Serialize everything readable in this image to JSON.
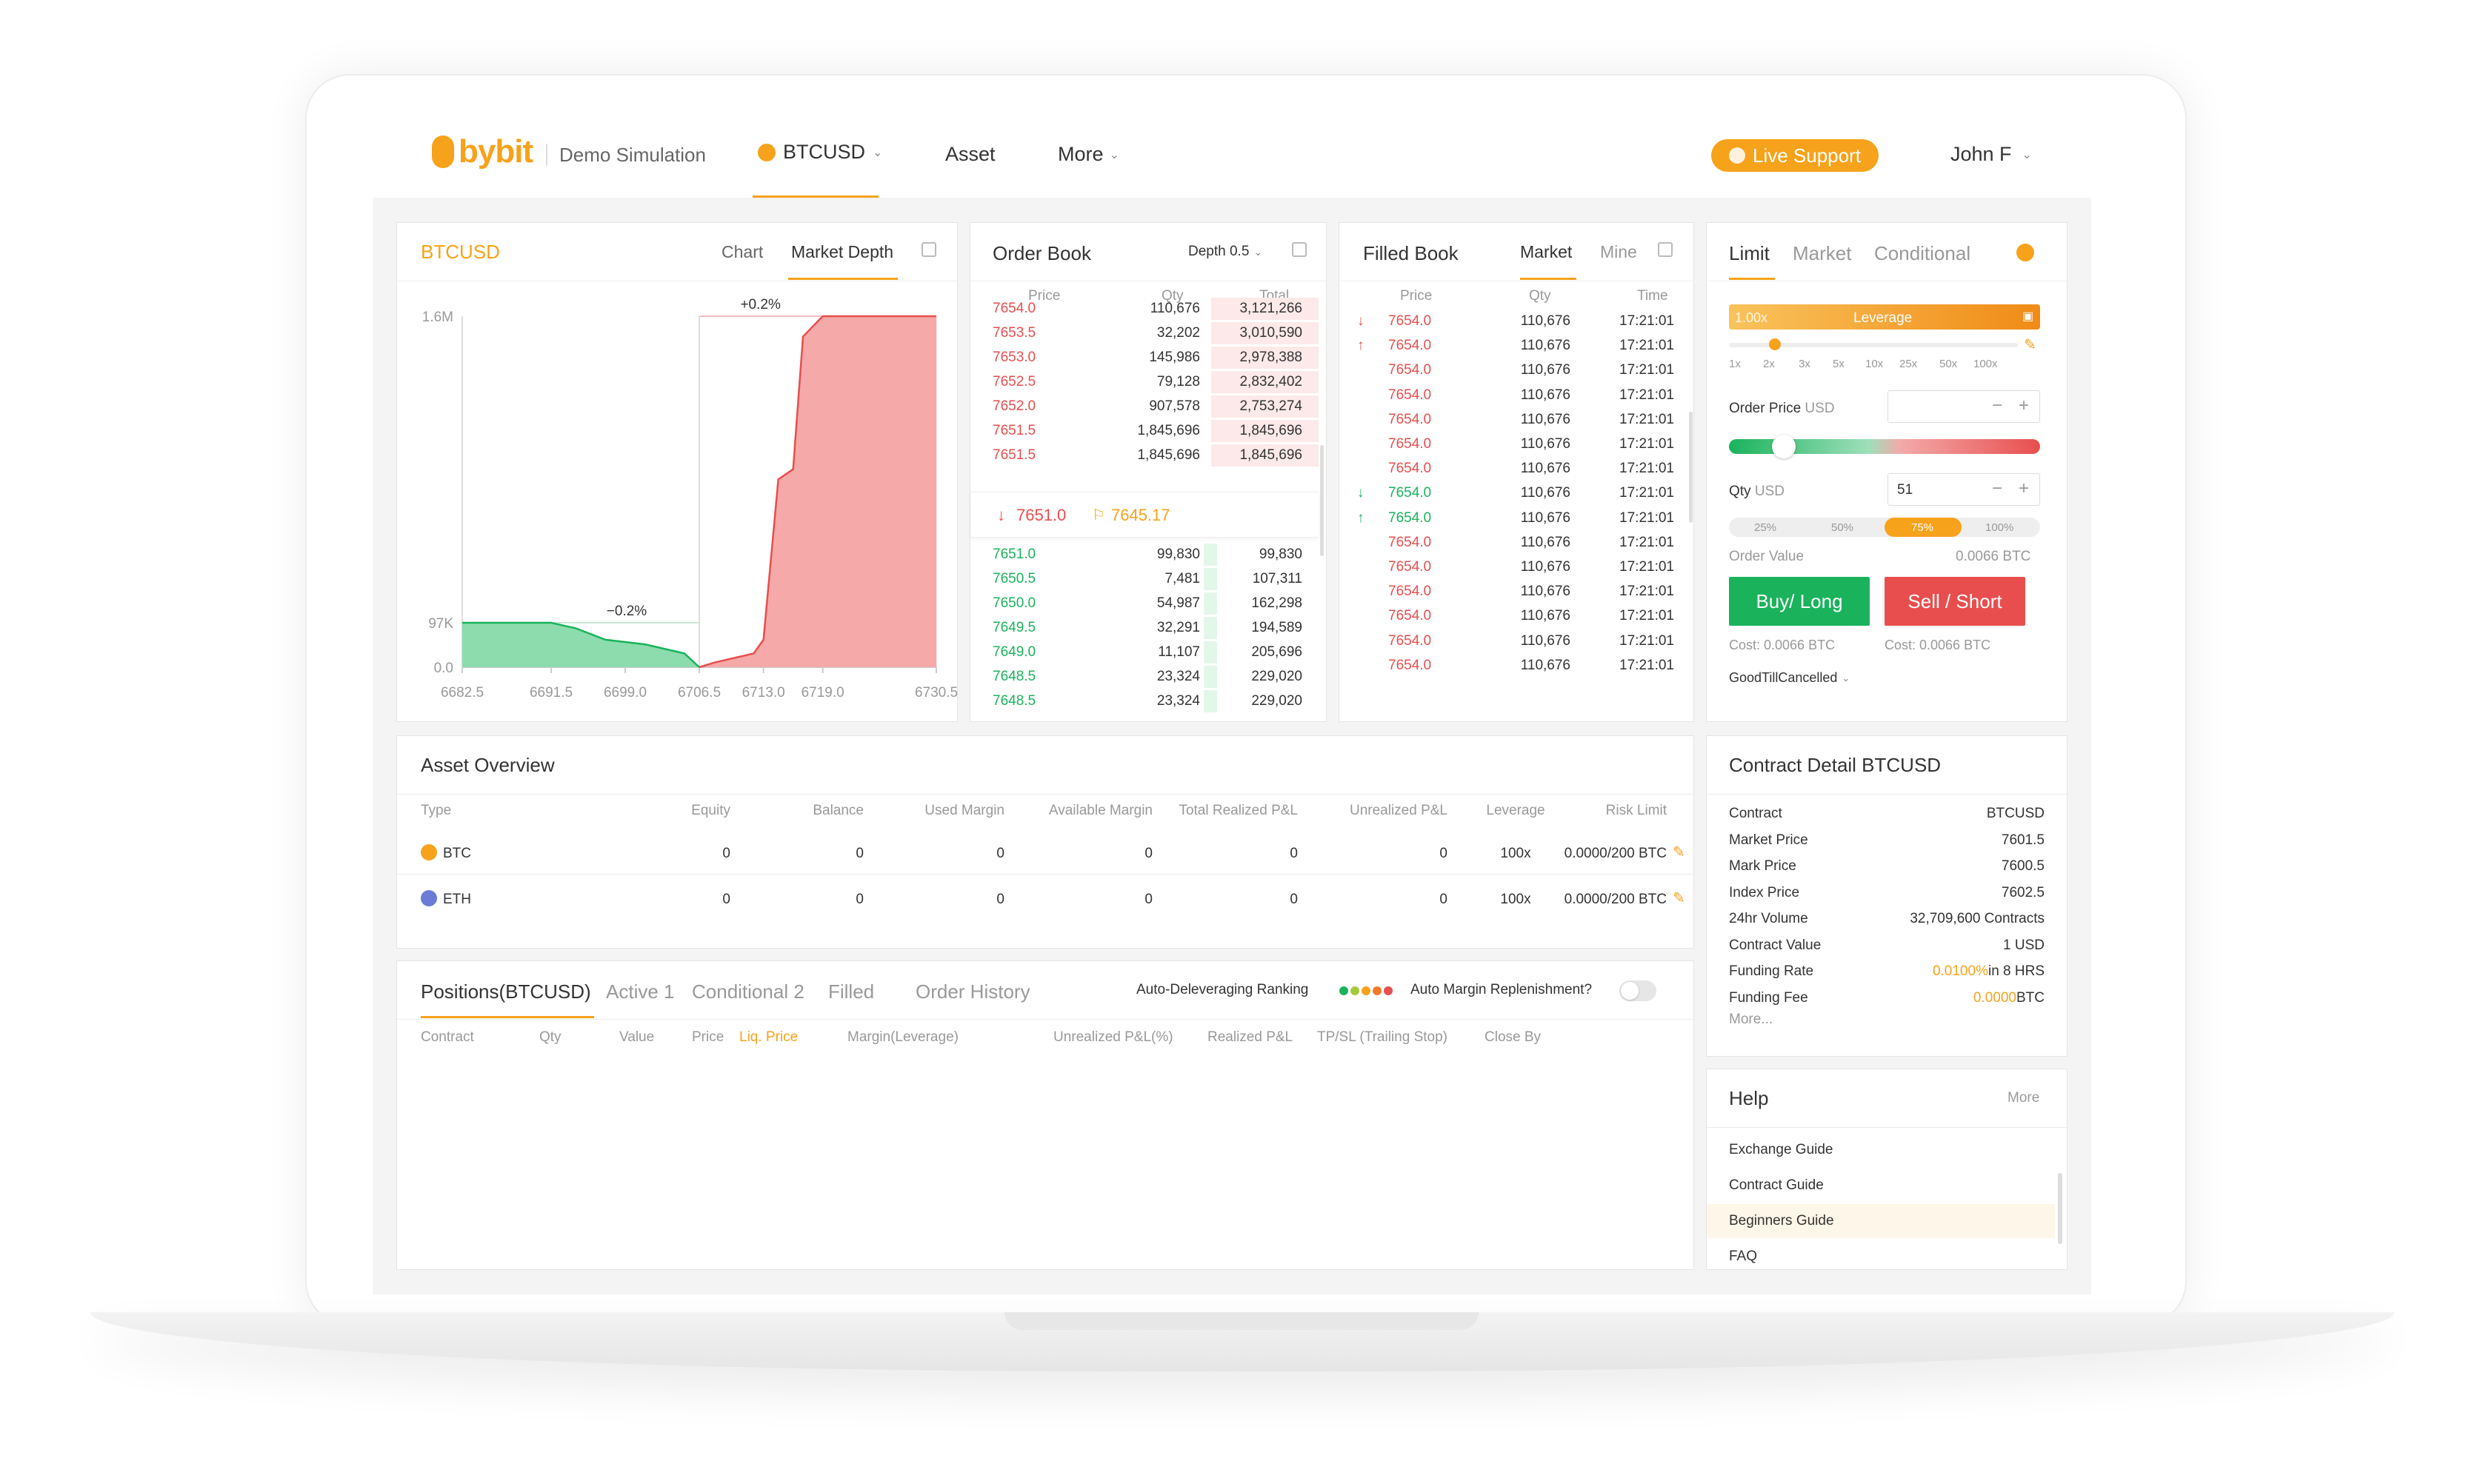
{
  "nav": {
    "brand": "bybit",
    "mode": "Demo Simulation",
    "symbol": "BTCUSD",
    "asset": "Asset",
    "more": "More",
    "support": "Live Support",
    "user": "John F"
  },
  "chartPanel": {
    "title": "BTCUSD",
    "tabs": [
      "Chart",
      "Market Depth"
    ],
    "active": "Market Depth"
  },
  "chart_data": {
    "type": "area",
    "x_ticks": [
      "6682.5",
      "6691.5",
      "6699.0",
      "6706.5",
      "6713.0",
      "6719.0",
      "6730.5"
    ],
    "y_ticks": [
      "1.6M",
      "97K",
      "0.0"
    ],
    "annotations": [
      "+0.2%",
      "−0.2%"
    ],
    "series": [
      {
        "color": "#1ab35c",
        "x": [
          6682.5,
          6691.5,
          6691.5,
          6694,
          6694,
          6697,
          6697,
          6701,
          6701,
          6703,
          6703,
          6705,
          6705,
          6706.5
        ],
        "y": [
          97000,
          97000,
          97000,
          85000,
          85000,
          60000,
          60000,
          50000,
          50000,
          40000,
          40000,
          30000,
          30000,
          0
        ]
      },
      {
        "color": "#e84e4e",
        "x": [
          6706.5,
          6708,
          6708,
          6710,
          6710,
          6712,
          6712,
          6713,
          6713,
          6714.5,
          6714.5,
          6716,
          6716,
          6717,
          6717,
          6719,
          6719,
          6730.5
        ],
        "y": [
          0,
          10000,
          10000,
          20000,
          20000,
          30000,
          30000,
          60000,
          60000,
          800000,
          800000,
          850000,
          850000,
          1500000,
          1500000,
          1600000,
          1600000,
          1600000
        ]
      }
    ]
  },
  "orderBook": {
    "title": "Order Book",
    "depth": "Depth 0.5",
    "headers": [
      "Price",
      "Qty",
      "Total"
    ],
    "asks": [
      [
        "7654.0",
        "110,676",
        "3,121,266"
      ],
      [
        "7653.5",
        "32,202",
        "3,010,590"
      ],
      [
        "7653.0",
        "145,986",
        "2,978,388"
      ],
      [
        "7652.5",
        "79,128",
        "2,832,402"
      ],
      [
        "7652.0",
        "907,578",
        "2,753,274"
      ],
      [
        "7651.5",
        "1,845,696",
        "1,845,696"
      ],
      [
        "7651.5",
        "1,845,696",
        "1,845,696"
      ]
    ],
    "last": "7651.0",
    "mark": "7645.17",
    "bids": [
      [
        "7651.0",
        "99,830",
        "99,830"
      ],
      [
        "7650.5",
        "7,481",
        "107,311"
      ],
      [
        "7650.0",
        "54,987",
        "162,298"
      ],
      [
        "7649.5",
        "32,291",
        "194,589"
      ],
      [
        "7649.0",
        "11,107",
        "205,696"
      ],
      [
        "7648.5",
        "23,324",
        "229,020"
      ],
      [
        "7648.5",
        "23,324",
        "229,020"
      ]
    ]
  },
  "filledBook": {
    "title": "Filled Book",
    "tabs": [
      "Market",
      "Mine"
    ],
    "headers": [
      "Price",
      "Qty",
      "Time"
    ],
    "rows": [
      [
        "down",
        "7654.0",
        "110,676",
        "17:21:01"
      ],
      [
        "up",
        "7654.0",
        "110,676",
        "17:21:01"
      ],
      [
        "",
        "7654.0",
        "110,676",
        "17:21:01"
      ],
      [
        "",
        "7654.0",
        "110,676",
        "17:21:01"
      ],
      [
        "",
        "7654.0",
        "110,676",
        "17:21:01"
      ],
      [
        "",
        "7654.0",
        "110,676",
        "17:21:01"
      ],
      [
        "",
        "7654.0",
        "110,676",
        "17:21:01"
      ],
      [
        "down",
        "7654.0",
        "110,676",
        "17:21:01"
      ],
      [
        "up",
        "7654.0",
        "110,676",
        "17:21:01"
      ],
      [
        "",
        "7654.0",
        "110,676",
        "17:21:01"
      ],
      [
        "",
        "7654.0",
        "110,676",
        "17:21:01"
      ],
      [
        "",
        "7654.0",
        "110,676",
        "17:21:01"
      ],
      [
        "",
        "7654.0",
        "110,676",
        "17:21:01"
      ],
      [
        "",
        "7654.0",
        "110,676",
        "17:21:01"
      ],
      [
        "",
        "7654.0",
        "110,676",
        "17:21:01"
      ]
    ]
  },
  "order": {
    "tabs": [
      "Limit",
      "Market",
      "Conditional"
    ],
    "leverage": "Leverage",
    "lev_value": "1.00x",
    "lev_ticks": [
      "1x",
      "2x",
      "3x",
      "5x",
      "10x",
      "25x",
      "50x",
      "100x"
    ],
    "price_label": "Order Price",
    "price_unit": "USD",
    "qty_label": "Qty",
    "qty_unit": "USD",
    "qty_value": "51",
    "pcts": [
      "25%",
      "50%",
      "75%",
      "100%"
    ],
    "ov_label": "Order Value",
    "ov_value": "0.0066 BTC",
    "buy": "Buy/ Long",
    "sell": "Sell / Short",
    "buy_cost": "Cost: 0.0066 BTC",
    "sell_cost": "Cost: 0.0066 BTC",
    "tif": "GoodTillCancelled"
  },
  "asset": {
    "title": "Asset Overview",
    "headers": [
      "Type",
      "Equity",
      "Balance",
      "Used Margin",
      "Available Margin",
      "Total Realized P&L",
      "Unrealized P&L",
      "Leverage",
      "Risk Limit"
    ],
    "rows": [
      [
        "BTC",
        "0",
        "0",
        "0",
        "0",
        "0",
        "0",
        "100x",
        "0.0000/200 BTC"
      ],
      [
        "ETH",
        "0",
        "0",
        "0",
        "0",
        "0",
        "0",
        "100x",
        "0.0000/200 BTC"
      ]
    ]
  },
  "positions": {
    "tabs": [
      "Positions(BTCUSD)",
      "Active 1",
      "Conditional 2",
      "Filled",
      "Order History"
    ],
    "adl": "Auto-Deleveraging Ranking",
    "amr": "Auto Margin Replenishment?",
    "headers": [
      "Contract",
      "Qty",
      "Value",
      "Price",
      "Liq. Price",
      "Margin(Leverage)",
      "Unrealized P&L(%)",
      "Realized P&L",
      "TP/SL (Trailing Stop)",
      "Close By"
    ]
  },
  "contract": {
    "title": "Contract Detail BTCUSD",
    "rows": [
      [
        "Contract",
        "BTCUSD",
        ""
      ],
      [
        "Market Price",
        "7601.5",
        ""
      ],
      [
        "Mark Price",
        "7600.5",
        ""
      ],
      [
        "Index Price",
        "7602.5",
        ""
      ],
      [
        "24hr Volume",
        "32,709,600 Contracts",
        ""
      ],
      [
        "Contract Value",
        "1 USD",
        ""
      ],
      [
        "Funding Rate",
        "0.0100%",
        "in 8 HRS"
      ],
      [
        "Funding Fee",
        "0.0000",
        "BTC"
      ]
    ],
    "more": "More..."
  },
  "help": {
    "title": "Help",
    "more": "More",
    "items": [
      "Exchange Guide",
      "Contract Guide",
      "Beginners Guide",
      "FAQ"
    ]
  }
}
